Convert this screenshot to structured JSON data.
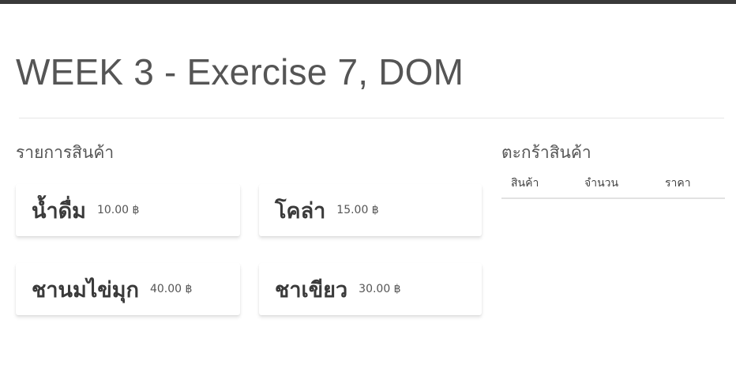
{
  "page": {
    "title": "WEEK 3 - Exercise 7, DOM"
  },
  "products": {
    "heading": "รายการสินค้า",
    "items": [
      {
        "name": "น้ำดื่ม",
        "price": "10.00 ฿"
      },
      {
        "name": "โคล่า",
        "price": "15.00 ฿"
      },
      {
        "name": "ชานมไข่มุก",
        "price": "40.00 ฿"
      },
      {
        "name": "ชาเขียว",
        "price": "30.00 ฿"
      }
    ]
  },
  "cart": {
    "heading": "ตะกร้าสินค้า",
    "columns": {
      "product": "สินค้า",
      "quantity": "จำนวน",
      "price": "ราคา"
    }
  }
}
